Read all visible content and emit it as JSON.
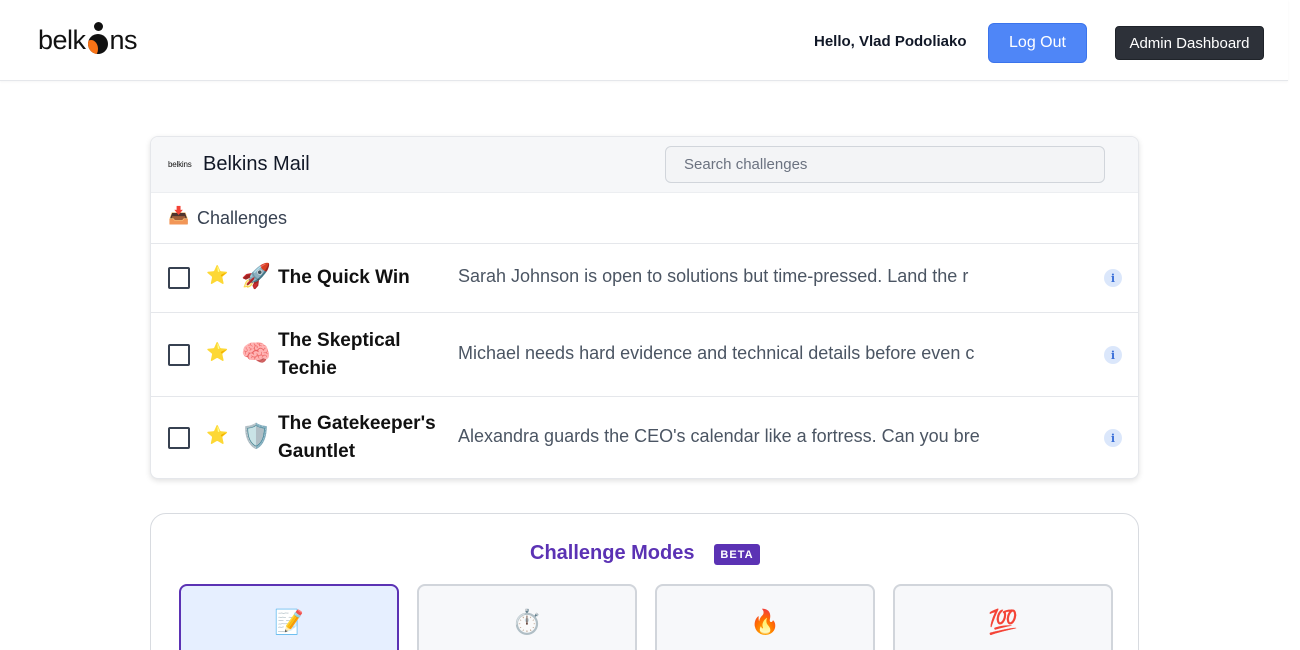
{
  "header": {
    "brand": "belkins",
    "greeting": "Hello, Vlad Podoliako",
    "logout_label": "Log Out",
    "admin_label": "Admin Dashboard",
    "accent_color": "#4f86f7"
  },
  "mail": {
    "logo_text": "belkins",
    "title": "Belkins Mail",
    "search_placeholder": "Search challenges",
    "folder_icon": "inbox-tray",
    "folder_label": "Challenges",
    "challenges": [
      {
        "starred": true,
        "emoji": "🚀",
        "icon_name": "rocket",
        "title": "The Quick Win",
        "description": "Sarah Johnson is open to solutions but time-pressed. Land the r"
      },
      {
        "starred": true,
        "emoji": "🧠",
        "icon_name": "brain",
        "title": "The Skeptical Techie",
        "description": "Michael needs hard evidence and technical details before even c"
      },
      {
        "starred": true,
        "emoji": "🛡️",
        "icon_name": "shield",
        "title": "The Gatekeeper's Gauntlet",
        "description": "Alexandra guards the CEO's calendar like a fortress. Can you bre"
      }
    ]
  },
  "modes": {
    "title": "Challenge Modes",
    "badge": "BETA",
    "accent_color": "#5b32b4",
    "tiles": [
      {
        "emoji": "📝",
        "icon_name": "memo",
        "active": true
      },
      {
        "emoji": "⏱️",
        "icon_name": "stopwatch",
        "active": false
      },
      {
        "emoji": "🔥",
        "icon_name": "fire",
        "active": false
      },
      {
        "emoji": "💯",
        "icon_name": "hundred-points",
        "active": false
      }
    ]
  }
}
